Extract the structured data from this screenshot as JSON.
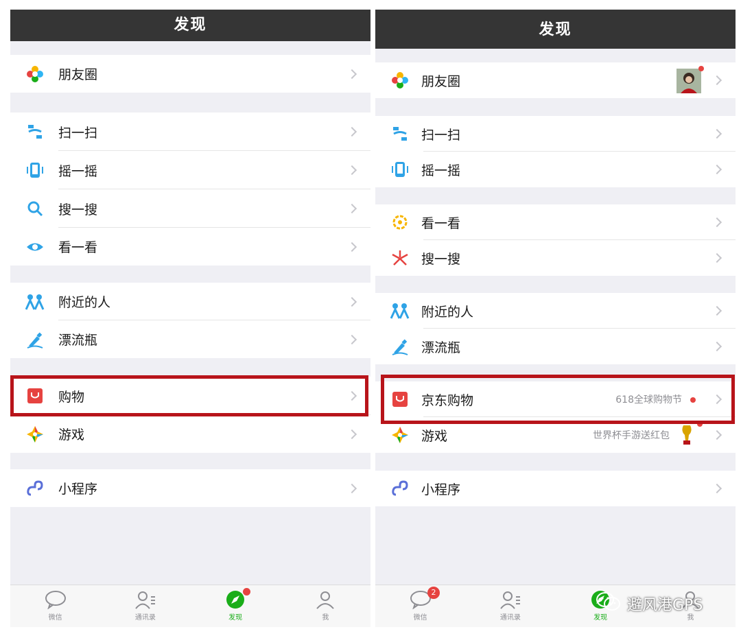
{
  "left": {
    "title": "发现",
    "items": [
      {
        "label": "朋友圈",
        "icon": "moments-icon"
      },
      {
        "label": "扫一扫",
        "icon": "scan-icon"
      },
      {
        "label": "摇一摇",
        "icon": "shake-icon"
      },
      {
        "label": "搜一搜",
        "icon": "search-icon"
      },
      {
        "label": "看一看",
        "icon": "eye-icon"
      },
      {
        "label": "附近的人",
        "icon": "people-nearby-icon"
      },
      {
        "label": "漂流瓶",
        "icon": "drift-bottle-icon"
      },
      {
        "label": "购物",
        "icon": "shopping-bag-icon"
      },
      {
        "label": "游戏",
        "icon": "games-icon"
      },
      {
        "label": "小程序",
        "icon": "mini-program-icon"
      }
    ],
    "tabs": [
      {
        "label": "微信",
        "icon": "chat-bubble-icon"
      },
      {
        "label": "通讯录",
        "icon": "contacts-icon"
      },
      {
        "label": "发现",
        "icon": "compass-icon",
        "active": true
      },
      {
        "label": "我",
        "icon": "profile-icon"
      }
    ]
  },
  "right": {
    "title": "发现",
    "items": [
      {
        "label": "朋友圈",
        "icon": "moments-icon"
      },
      {
        "label": "扫一扫",
        "icon": "scan-icon"
      },
      {
        "label": "摇一摇",
        "icon": "shake-icon"
      },
      {
        "label": "看一看",
        "icon": "look-icon"
      },
      {
        "label": "搜一搜",
        "icon": "search-star-icon"
      },
      {
        "label": "附近的人",
        "icon": "people-nearby-icon"
      },
      {
        "label": "漂流瓶",
        "icon": "drift-bottle-icon"
      },
      {
        "label": "京东购物",
        "icon": "shopping-bag-icon",
        "extra": "618全球购物节"
      },
      {
        "label": "游戏",
        "icon": "games-icon",
        "extra": "世界杯手游送红包"
      },
      {
        "label": "小程序",
        "icon": "mini-program-icon"
      }
    ],
    "tabs": [
      {
        "label": "微信",
        "icon": "chat-bubble-icon",
        "badge": "2"
      },
      {
        "label": "通讯录",
        "icon": "contacts-icon"
      },
      {
        "label": "发现",
        "icon": "compass-icon",
        "active": true
      },
      {
        "label": "我",
        "icon": "profile-icon"
      }
    ]
  },
  "watermark": {
    "text": "避风港GPS"
  },
  "colors": {
    "accent": "#1aad19",
    "highlight": "#b8141a",
    "titlebar": "#353535",
    "badge": "#e64340"
  }
}
